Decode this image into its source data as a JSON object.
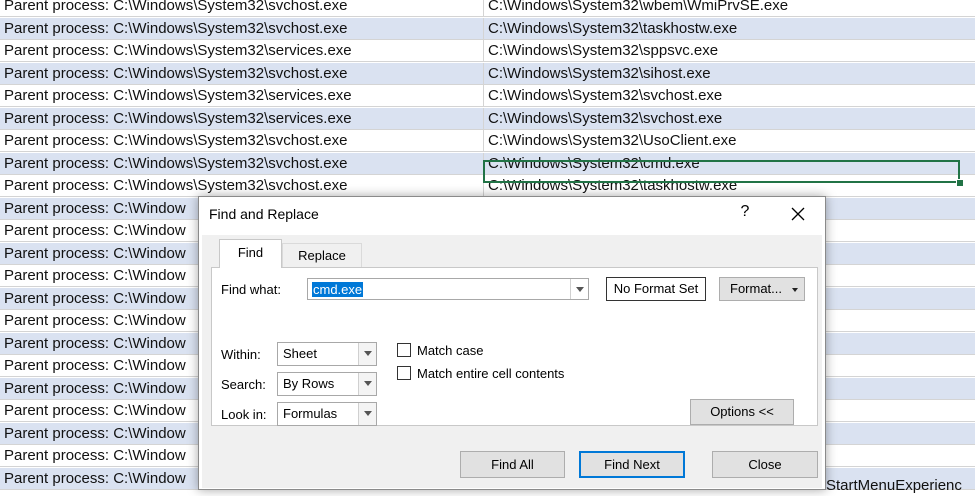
{
  "sheet": {
    "rows": [
      {
        "a": "Parent process: C:\\Windows\\System32\\svchost.exe",
        "b": "C:\\Windows\\System32\\wbem\\WmiPrvSE.exe"
      },
      {
        "a": "Parent process: C:\\Windows\\System32\\svchost.exe",
        "b": "C:\\Windows\\System32\\taskhostw.exe"
      },
      {
        "a": "Parent process: C:\\Windows\\System32\\services.exe",
        "b": "C:\\Windows\\System32\\sppsvc.exe"
      },
      {
        "a": "Parent process: C:\\Windows\\System32\\svchost.exe",
        "b": "C:\\Windows\\System32\\sihost.exe"
      },
      {
        "a": "Parent process: C:\\Windows\\System32\\services.exe",
        "b": "C:\\Windows\\System32\\svchost.exe"
      },
      {
        "a": "Parent process: C:\\Windows\\System32\\services.exe",
        "b": "C:\\Windows\\System32\\svchost.exe"
      },
      {
        "a": "Parent process: C:\\Windows\\System32\\svchost.exe",
        "b": "C:\\Windows\\System32\\UsoClient.exe"
      },
      {
        "a": "Parent process: C:\\Windows\\System32\\svchost.exe",
        "b": "C:\\Windows\\System32\\cmd.exe"
      },
      {
        "a": "Parent process: C:\\Windows\\System32\\svchost.exe",
        "b": "C:\\Windows\\System32\\taskhostw.exe"
      },
      {
        "a": "Parent process: C:\\Window",
        "b": ""
      },
      {
        "a": "Parent process: C:\\Window",
        "b": ""
      },
      {
        "a": "Parent process: C:\\Window",
        "b": ""
      },
      {
        "a": "Parent process: C:\\Window",
        "b": ""
      },
      {
        "a": "Parent process: C:\\Window",
        "b": ""
      },
      {
        "a": "Parent process: C:\\Window",
        "b": ""
      },
      {
        "a": "Parent process: C:\\Window",
        "b": ""
      },
      {
        "a": "Parent process: C:\\Window",
        "b": ""
      },
      {
        "a": "Parent process: C:\\Window",
        "b": ""
      },
      {
        "a": "Parent process: C:\\Window",
        "b": ""
      },
      {
        "a": "Parent process: C:\\Window",
        "b": ""
      },
      {
        "a": "Parent process: C:\\Window",
        "b": ""
      },
      {
        "a": "Parent process: C:\\Window",
        "b": ""
      }
    ],
    "last_row_tail": "StartMenuExperienc"
  },
  "dialog": {
    "title": "Find and Replace",
    "help": "?",
    "tabs": {
      "find": "Find",
      "replace": "Replace"
    },
    "find_what_label": "Find what:",
    "find_what_value": "cmd.exe",
    "no_format": "No Format Set",
    "format_button": "Format...",
    "within_label": "Within:",
    "within_value": "Sheet",
    "search_label": "Search:",
    "search_value": "By Rows",
    "lookin_label": "Look in:",
    "lookin_value": "Formulas",
    "match_case": "Match case",
    "match_entire": "Match entire cell contents",
    "options_button": "Options <<",
    "find_all": "Find All",
    "find_next": "Find Next",
    "close": "Close"
  }
}
